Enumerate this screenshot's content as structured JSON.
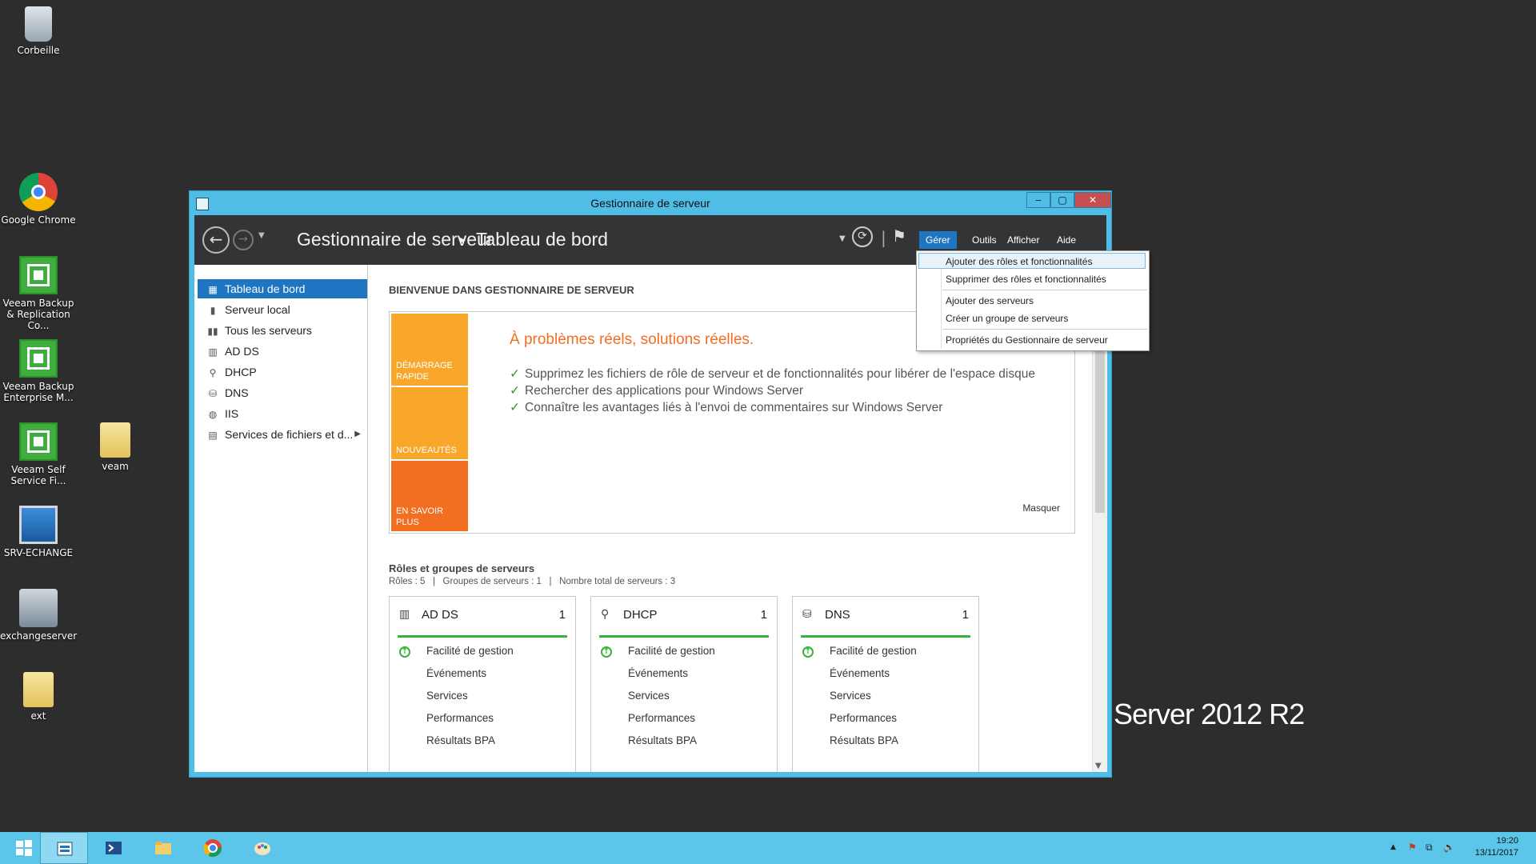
{
  "desktop": {
    "icons": [
      {
        "label": "Corbeille",
        "icon": "recycle-bin-icon"
      },
      {
        "label": "Google Chrome",
        "icon": "chrome-icon"
      },
      {
        "label": "Veeam Backup & Replication Co...",
        "icon": "veeam-icon"
      },
      {
        "label": "Veeam Backup Enterprise M...",
        "icon": "veeam-icon"
      },
      {
        "label": "Veeam Self Service Fi...",
        "icon": "veeam-icon"
      },
      {
        "label": "veam",
        "icon": "folder-icon"
      },
      {
        "label": "SRV-ECHANGE",
        "icon": "computer-icon"
      },
      {
        "label": "exchangeserver",
        "icon": "exchange-icon"
      },
      {
        "label": "ext",
        "icon": "folder-icon"
      }
    ],
    "branding": "Server 2012 R2"
  },
  "window": {
    "title": "Gestionnaire de serveur",
    "buttons": {
      "minimize": "‒",
      "maximize": "▢",
      "close": "✕"
    },
    "header": {
      "breadcrumb_root": "Gestionnaire de serveur",
      "breadcrumb_sep": "▸",
      "breadcrumb_current": "Tableau de bord",
      "menus": [
        "Gérer",
        "Outils",
        "Afficher",
        "Aide"
      ],
      "active_menu": "Gérer"
    },
    "sidebar": {
      "items": [
        {
          "label": "Tableau de bord",
          "icon": "dashboard-icon",
          "selected": true
        },
        {
          "label": "Serveur local",
          "icon": "server-icon"
        },
        {
          "label": "Tous les serveurs",
          "icon": "servers-icon"
        },
        {
          "label": "AD DS",
          "icon": "adds-icon"
        },
        {
          "label": "DHCP",
          "icon": "dhcp-icon"
        },
        {
          "label": "DNS",
          "icon": "dns-icon"
        },
        {
          "label": "IIS",
          "icon": "iis-icon"
        },
        {
          "label": "Services de fichiers et d...",
          "icon": "file-services-icon",
          "has_submenu": true
        }
      ]
    },
    "main": {
      "welcome_title": "BIENVENUE DANS GESTIONNAIRE DE SERVEUR",
      "tiles": [
        "DÉMARRAGE RAPIDE",
        "NOUVEAUTÉS",
        "EN SAVOIR PLUS"
      ],
      "tagline": "À problèmes réels, solutions réelles.",
      "tips": [
        "Supprimez les fichiers de rôle de serveur et de fonctionnalités pour libérer de l'espace disque",
        "Rechercher des applications pour Windows Server",
        "Connaître les avantages liés à l'envoi de commentaires sur Windows Server"
      ],
      "hide_label": "Masquer",
      "roles_title": "Rôles et groupes de serveurs",
      "roles_stats": "Rôles : 5   |   Groupes de serveurs : 1   |   Nombre total de serveurs : 3",
      "role_cards": [
        {
          "name": "AD DS",
          "count": "1",
          "rows": [
            "Facilité de gestion",
            "Événements",
            "Services",
            "Performances",
            "Résultats BPA"
          ]
        },
        {
          "name": "DHCP",
          "count": "1",
          "rows": [
            "Facilité de gestion",
            "Événements",
            "Services",
            "Performances",
            "Résultats BPA"
          ]
        },
        {
          "name": "DNS",
          "count": "1",
          "rows": [
            "Facilité de gestion",
            "Événements",
            "Services",
            "Performances",
            "Résultats BPA"
          ]
        }
      ]
    },
    "dropdown": {
      "items": [
        "Ajouter des rôles et fonctionnalités",
        "Supprimer des rôles et fonctionnalités",
        "Ajouter des serveurs",
        "Créer un groupe de serveurs",
        "Propriétés du Gestionnaire de serveur"
      ]
    }
  },
  "taskbar": {
    "apps": [
      "start-button",
      "server-manager",
      "powershell",
      "file-explorer",
      "chrome",
      "paint"
    ],
    "clock_time": "19:20",
    "clock_date": "13/11/2017",
    "tray_arrow": "▲"
  },
  "colors": {
    "accent": "#1e76c2",
    "tile_orange": "#f9a72b",
    "tile_red": "#f26e21",
    "ok_green": "#37b337",
    "taskbar": "#5bc6ea"
  }
}
